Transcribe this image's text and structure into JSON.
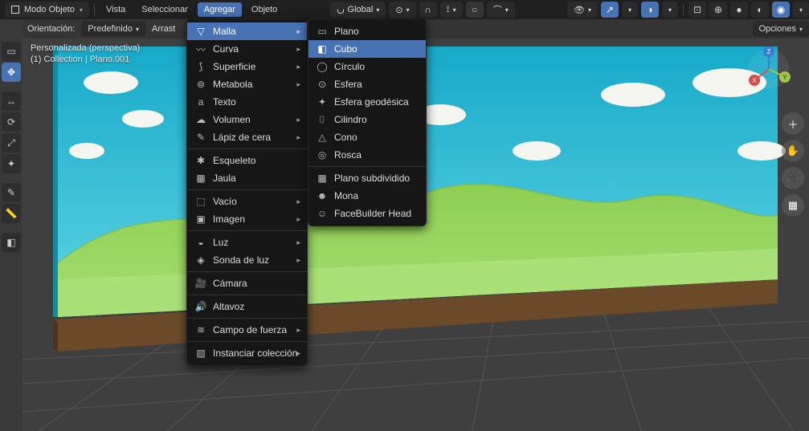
{
  "header": {
    "mode": "Modo Objeto",
    "menus": [
      "Vista",
      "Seleccionar",
      "Agregar",
      "Objeto"
    ],
    "active_menu": 2,
    "orientation_label": "Global",
    "options_label": "Opciones"
  },
  "secondbar": {
    "orientation_label": "Orientación:",
    "preset": "Predefinido",
    "drag": "Arrast"
  },
  "viewport_info": {
    "line1": "Personalizada (perspectiva)",
    "line2": "(1) Collection | Plano.001"
  },
  "add_menu": {
    "groups": [
      [
        {
          "icon": "mesh",
          "label": "Malla",
          "sub": true,
          "hi": true
        },
        {
          "icon": "curve",
          "label": "Curva",
          "sub": true
        },
        {
          "icon": "surface",
          "label": "Superficie",
          "sub": true
        },
        {
          "icon": "meta",
          "label": "Metabola",
          "sub": true
        },
        {
          "icon": "text",
          "label": "Texto"
        },
        {
          "icon": "volume",
          "label": "Volumen",
          "sub": true
        },
        {
          "icon": "gpencil",
          "label": "Lápiz de cera",
          "sub": true
        }
      ],
      [
        {
          "icon": "armature",
          "label": "Esqueleto"
        },
        {
          "icon": "lattice",
          "label": "Jaula"
        }
      ],
      [
        {
          "icon": "empty",
          "label": "Vacío",
          "sub": true
        },
        {
          "icon": "image",
          "label": "Imagen",
          "sub": true
        }
      ],
      [
        {
          "icon": "light",
          "label": "Luz",
          "sub": true
        },
        {
          "icon": "probe",
          "label": "Sonda de luz",
          "sub": true
        }
      ],
      [
        {
          "icon": "camera",
          "label": "Cámara"
        }
      ],
      [
        {
          "icon": "speaker",
          "label": "Altavoz"
        }
      ],
      [
        {
          "icon": "force",
          "label": "Campo de fuerza",
          "sub": true
        }
      ],
      [
        {
          "icon": "collection",
          "label": "Instanciar colección",
          "sub": true
        }
      ]
    ]
  },
  "mesh_submenu": {
    "groups": [
      [
        {
          "icon": "plane",
          "label": "Plano"
        },
        {
          "icon": "cube",
          "label": "Cubo",
          "sel": true
        },
        {
          "icon": "circle",
          "label": "Círculo"
        },
        {
          "icon": "uvsphere",
          "label": "Esfera"
        },
        {
          "icon": "ico",
          "label": "Esfera geodésica"
        },
        {
          "icon": "cyl",
          "label": "Cilindro"
        },
        {
          "icon": "cone",
          "label": "Cono"
        },
        {
          "icon": "torus",
          "label": "Rosca"
        }
      ],
      [
        {
          "icon": "grid",
          "label": "Plano subdividido"
        },
        {
          "icon": "monkey",
          "label": "Mona"
        },
        {
          "icon": "face",
          "label": "FaceBuilder Head"
        }
      ]
    ]
  },
  "axes": {
    "x": "X",
    "y": "Y",
    "z": "Z"
  }
}
